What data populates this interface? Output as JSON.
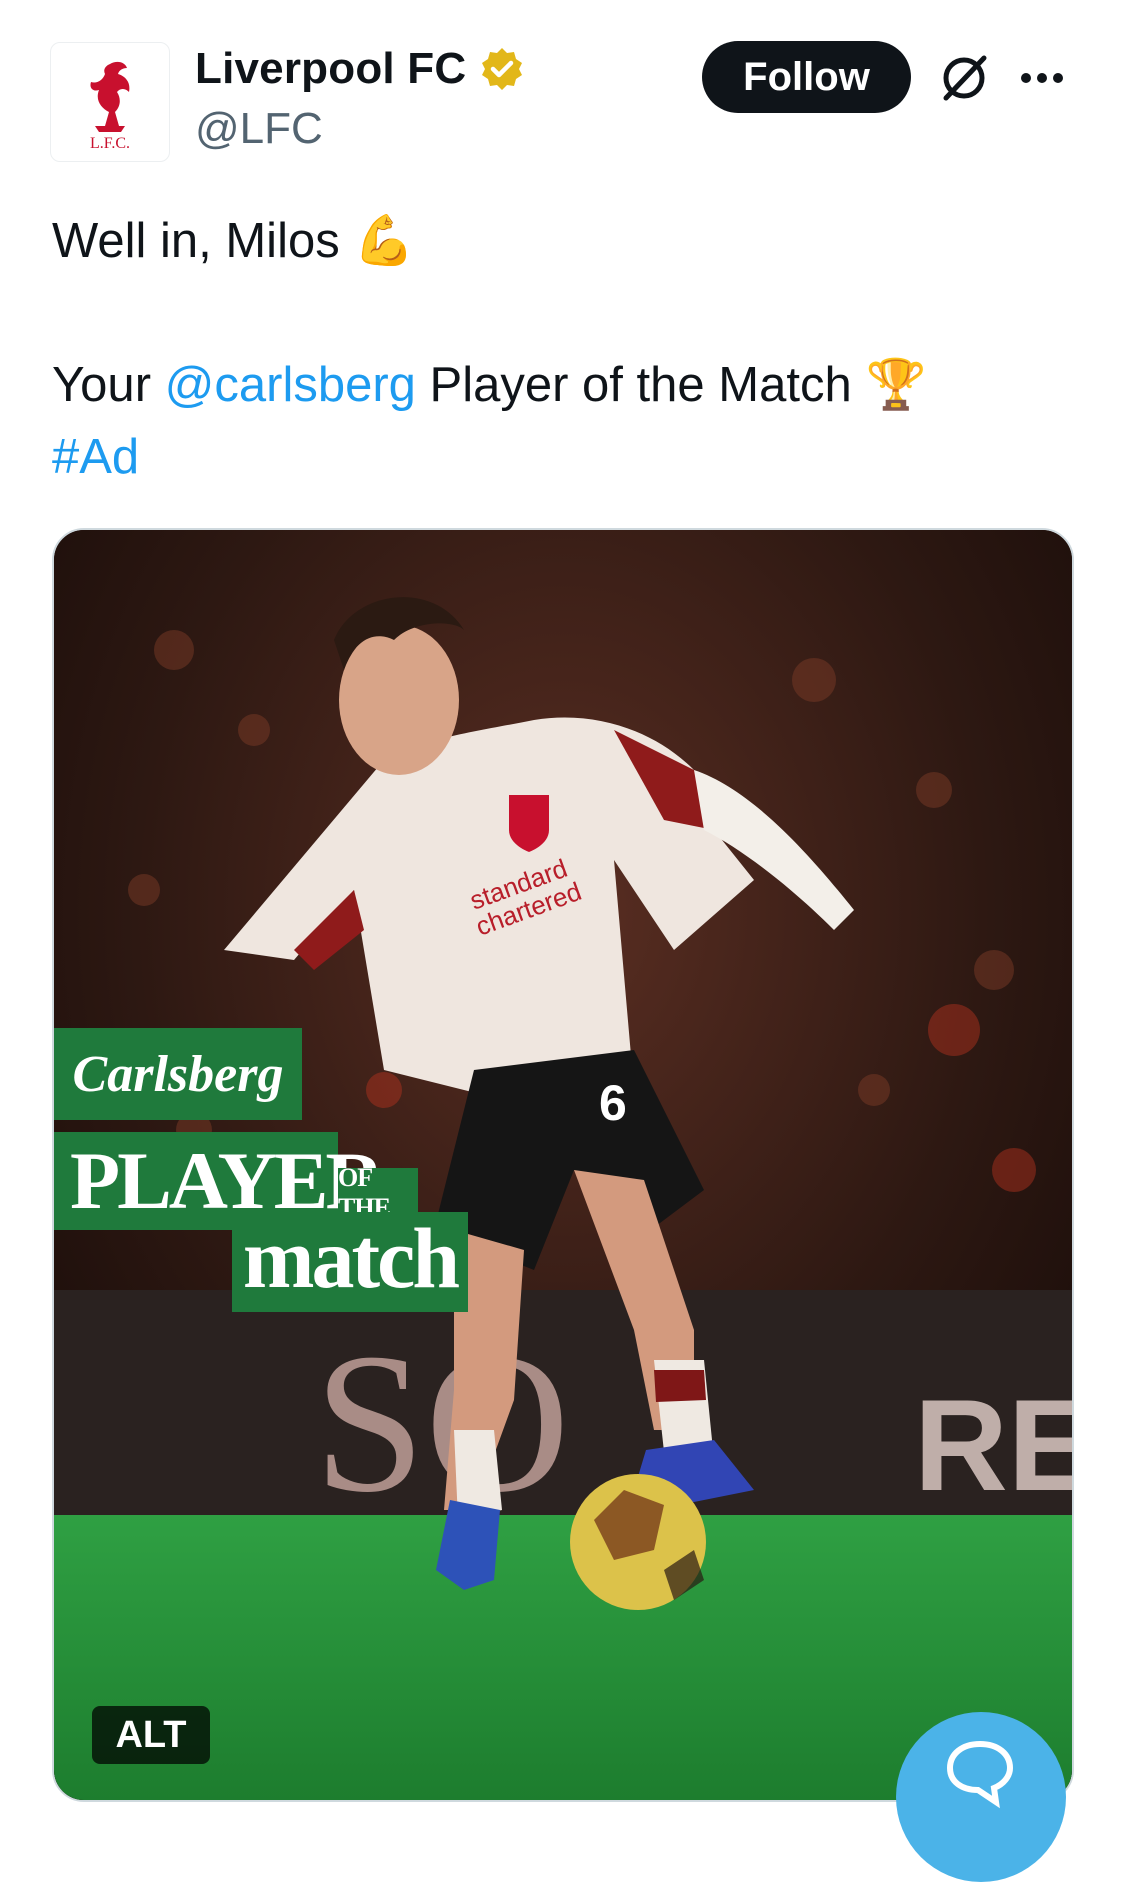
{
  "account": {
    "display_name": "Liverpool FC",
    "handle": "@LFC",
    "verified_badge": "gold-verified-icon",
    "avatar_text": "L.F.C."
  },
  "actions": {
    "follow_label": "Follow",
    "grok_icon": "grok-icon",
    "more_icon": "more-icon"
  },
  "tweet": {
    "line1": "Well in, Milos",
    "line1_emoji": "💪",
    "line2_prefix": "Your",
    "line2_mention": "@carlsberg",
    "line2_suffix": "Player of the Match",
    "line2_emoji": "🏆",
    "hashtag": "#Ad"
  },
  "media": {
    "alt_label": "ALT",
    "badge_brand": "Carlsberg",
    "badge_player": "PLAYER",
    "badge_ofthe": "OF THE",
    "badge_match": "match",
    "shirt_sponsor_line1": "standard",
    "shirt_sponsor_line2": "chartered",
    "shirt_number": "6",
    "board_text_left": "SO",
    "board_text_right": "RE"
  },
  "colors": {
    "link": "#1d9bf0",
    "follow_bg": "#0f1419",
    "carlsberg_green": "#1f7a3c",
    "verified_gold": "#e2b719",
    "fab_blue": "#4bb3e8"
  }
}
